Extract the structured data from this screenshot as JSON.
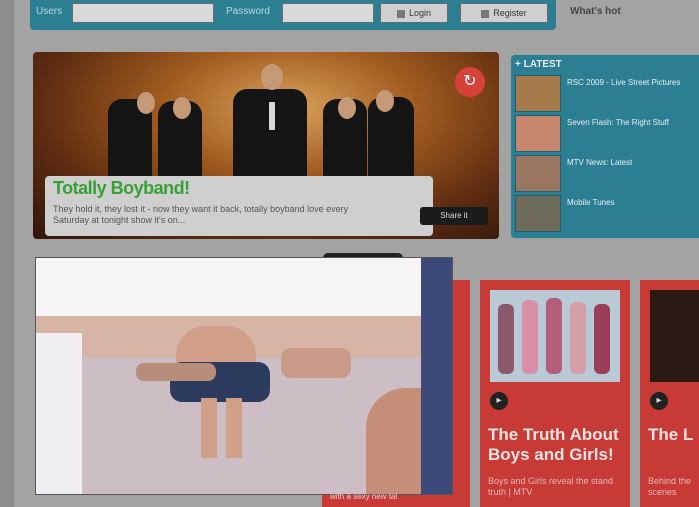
{
  "login": {
    "username_label": "Users",
    "password_label": "Password",
    "login_button": "Login",
    "register_button": "Register",
    "whats_hot": "What's hot"
  },
  "hero": {
    "title": "Totally Boyband!",
    "description": "They hold it, they lost it - now they want it back, totally boyband love every Saturday at tonight show it's on...",
    "share_label": "Share it",
    "refresh_icon": "refresh-icon"
  },
  "latest": {
    "heading": "+ LATEST",
    "items": [
      {
        "text": "RSC 2009 - Live Street Pictures"
      },
      {
        "text": "Seven Flash: The Right Stuff"
      },
      {
        "text": "MTV News: Latest"
      },
      {
        "text": "Mobile Tunes"
      }
    ]
  },
  "cards": [
    {
      "title": "The Truth About Boys and Girls!",
      "desc": "Boys and Girls reveal the stand truth | MTV"
    },
    {
      "title": "The L Back",
      "desc": "Behind the scenes"
    }
  ],
  "video": {
    "caption": "with a sexy new tal"
  },
  "colors": {
    "accent_blue": "#2c7e93",
    "card_red": "#c73a35",
    "title_green": "#37a037"
  }
}
